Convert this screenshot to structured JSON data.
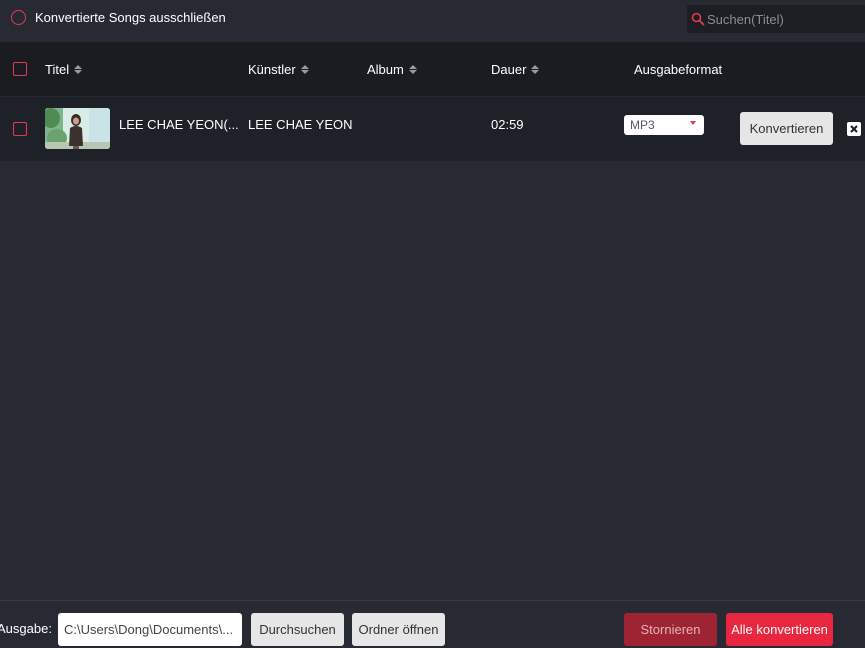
{
  "topbar": {
    "exclude_label": "Konvertierte Songs ausschließen",
    "search_placeholder": "Suchen(Titel)",
    "search_value": ""
  },
  "table": {
    "headers": {
      "title": "Titel",
      "artist": "Künstler",
      "album": "Album",
      "duration": "Dauer",
      "output_format": "Ausgabeformat"
    },
    "rows": [
      {
        "title": "LEE CHAE YEON(...",
        "artist": "LEE CHAE YEON",
        "album": "",
        "duration": "02:59",
        "format": "MP3",
        "convert_label": "Konvertieren"
      }
    ]
  },
  "bottombar": {
    "output_label": "Ausgabe:",
    "output_path": "C:\\Users\\Dong\\Documents\\...",
    "browse_label": "Durchsuchen",
    "open_folder_label": "Ordner öffnen",
    "cancel_label": "Stornieren",
    "convert_all_label": "Alle konvertieren"
  },
  "colors": {
    "accent": "#e8394d",
    "background": "#272a33",
    "header_bg": "#1a1c22",
    "row_bg": "#1f2128",
    "cancel_bg": "#9e2333",
    "convert_all_bg": "#e8263f"
  }
}
